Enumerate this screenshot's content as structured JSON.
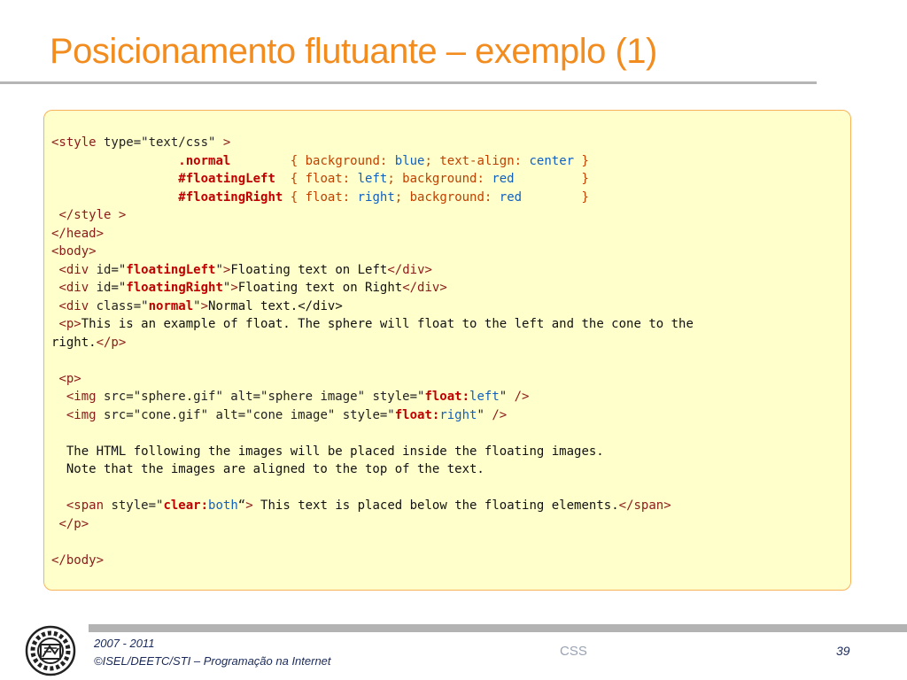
{
  "slide": {
    "title": "Posicionamento flutuante – exemplo (1)"
  },
  "code": {
    "lines": [
      [
        {
          "c": "t",
          "s": "<style"
        },
        {
          "c": "a",
          "s": " type=\"text/css\" "
        },
        {
          "c": "t",
          "s": ">"
        }
      ],
      [
        {
          "c": "",
          "s": "                 "
        },
        {
          "c": "v",
          "s": ".normal"
        },
        {
          "c": "",
          "s": "        "
        },
        {
          "c": "p",
          "s": "{ background: "
        },
        {
          "c": "k",
          "s": "blue"
        },
        {
          "c": "p",
          "s": "; text-align: "
        },
        {
          "c": "k",
          "s": "center"
        },
        {
          "c": "p",
          "s": " }"
        }
      ],
      [
        {
          "c": "",
          "s": "                 "
        },
        {
          "c": "v",
          "s": "#floatingLeft"
        },
        {
          "c": "",
          "s": "  "
        },
        {
          "c": "p",
          "s": "{ float: "
        },
        {
          "c": "k",
          "s": "left"
        },
        {
          "c": "p",
          "s": "; background: "
        },
        {
          "c": "k",
          "s": "red"
        },
        {
          "c": "p",
          "s": "         }"
        }
      ],
      [
        {
          "c": "",
          "s": "                 "
        },
        {
          "c": "v",
          "s": "#floatingRight"
        },
        {
          "c": "",
          "s": " "
        },
        {
          "c": "p",
          "s": "{ float: "
        },
        {
          "c": "k",
          "s": "right"
        },
        {
          "c": "p",
          "s": "; background: "
        },
        {
          "c": "k",
          "s": "red"
        },
        {
          "c": "p",
          "s": "        }"
        }
      ],
      [
        {
          "c": "",
          "s": " "
        },
        {
          "c": "t",
          "s": "</style >"
        }
      ],
      [
        {
          "c": "t",
          "s": "</head>"
        }
      ],
      [
        {
          "c": "t",
          "s": "<body>"
        }
      ],
      [
        {
          "c": "",
          "s": " "
        },
        {
          "c": "t",
          "s": "<div"
        },
        {
          "c": "a",
          "s": " id=\""
        },
        {
          "c": "v",
          "s": "floatingLeft"
        },
        {
          "c": "a",
          "s": "\""
        },
        {
          "c": "t",
          "s": ">"
        },
        {
          "c": "",
          "s": "Floating text on Left"
        },
        {
          "c": "t",
          "s": "</div>"
        }
      ],
      [
        {
          "c": "",
          "s": " "
        },
        {
          "c": "t",
          "s": "<div"
        },
        {
          "c": "a",
          "s": " id=\""
        },
        {
          "c": "v",
          "s": "floatingRight"
        },
        {
          "c": "a",
          "s": "\""
        },
        {
          "c": "t",
          "s": ">"
        },
        {
          "c": "",
          "s": "Floating text on Right"
        },
        {
          "c": "t",
          "s": "</div>"
        }
      ],
      [
        {
          "c": "",
          "s": " "
        },
        {
          "c": "t",
          "s": "<div"
        },
        {
          "c": "a",
          "s": " class=\""
        },
        {
          "c": "v",
          "s": "normal"
        },
        {
          "c": "a",
          "s": "\""
        },
        {
          "c": "t",
          "s": ">"
        },
        {
          "c": "",
          "s": "Normal text.</div>"
        }
      ],
      [
        {
          "c": "",
          "s": " "
        },
        {
          "c": "t",
          "s": "<p>"
        },
        {
          "c": "",
          "s": "This is an example of float. The sphere will float to the left and the cone to the"
        }
      ],
      [
        {
          "c": "",
          "s": "right."
        },
        {
          "c": "t",
          "s": "</p>"
        }
      ],
      [
        {
          "c": "",
          "s": ""
        }
      ],
      [
        {
          "c": "",
          "s": " "
        },
        {
          "c": "t",
          "s": "<p>"
        }
      ],
      [
        {
          "c": "",
          "s": "  "
        },
        {
          "c": "t",
          "s": "<img"
        },
        {
          "c": "a",
          "s": " src=\"sphere.gif\" alt=\"sphere image\" style=\""
        },
        {
          "c": "v",
          "s": "float:"
        },
        {
          "c": "k",
          "s": "left"
        },
        {
          "c": "a",
          "s": "\" "
        },
        {
          "c": "t",
          "s": "/>"
        }
      ],
      [
        {
          "c": "",
          "s": "  "
        },
        {
          "c": "t",
          "s": "<img"
        },
        {
          "c": "a",
          "s": " src=\"cone.gif\" alt=\"cone image\" style=\""
        },
        {
          "c": "v",
          "s": "float:"
        },
        {
          "c": "k",
          "s": "right"
        },
        {
          "c": "a",
          "s": "\" "
        },
        {
          "c": "t",
          "s": "/>"
        }
      ],
      [
        {
          "c": "",
          "s": ""
        }
      ],
      [
        {
          "c": "",
          "s": "  The HTML following the images will be placed inside the floating images."
        }
      ],
      [
        {
          "c": "",
          "s": "  Note that the images are aligned to the top of the text."
        }
      ],
      [
        {
          "c": "",
          "s": ""
        }
      ],
      [
        {
          "c": "",
          "s": "  "
        },
        {
          "c": "t",
          "s": "<span"
        },
        {
          "c": "a",
          "s": " style=\""
        },
        {
          "c": "v",
          "s": "clear:"
        },
        {
          "c": "k",
          "s": "both"
        },
        {
          "c": "a",
          "s": "“"
        },
        {
          "c": "t",
          "s": ">"
        },
        {
          "c": "",
          "s": " This text is placed below the floating elements."
        },
        {
          "c": "t",
          "s": "</span>"
        }
      ],
      [
        {
          "c": "",
          "s": " "
        },
        {
          "c": "t",
          "s": "</p>"
        }
      ],
      [
        {
          "c": "",
          "s": ""
        }
      ],
      [
        {
          "c": "t",
          "s": "</body>"
        }
      ]
    ]
  },
  "footer": {
    "years": "2007 - 2011",
    "credit": "©ISEL/DEETC/STI – Programação na Internet",
    "topic": "CSS",
    "page_number": "39"
  },
  "colors": {
    "title": "#F28C1F",
    "code_background": "#FFFFCC",
    "code_border": "#F7B25B",
    "tag": "#8B1A1A",
    "selector": "#C00000",
    "property": "#C04000",
    "keyword": "#1060C0"
  },
  "icons": {
    "logo": "isel-gear-logo-icon"
  }
}
